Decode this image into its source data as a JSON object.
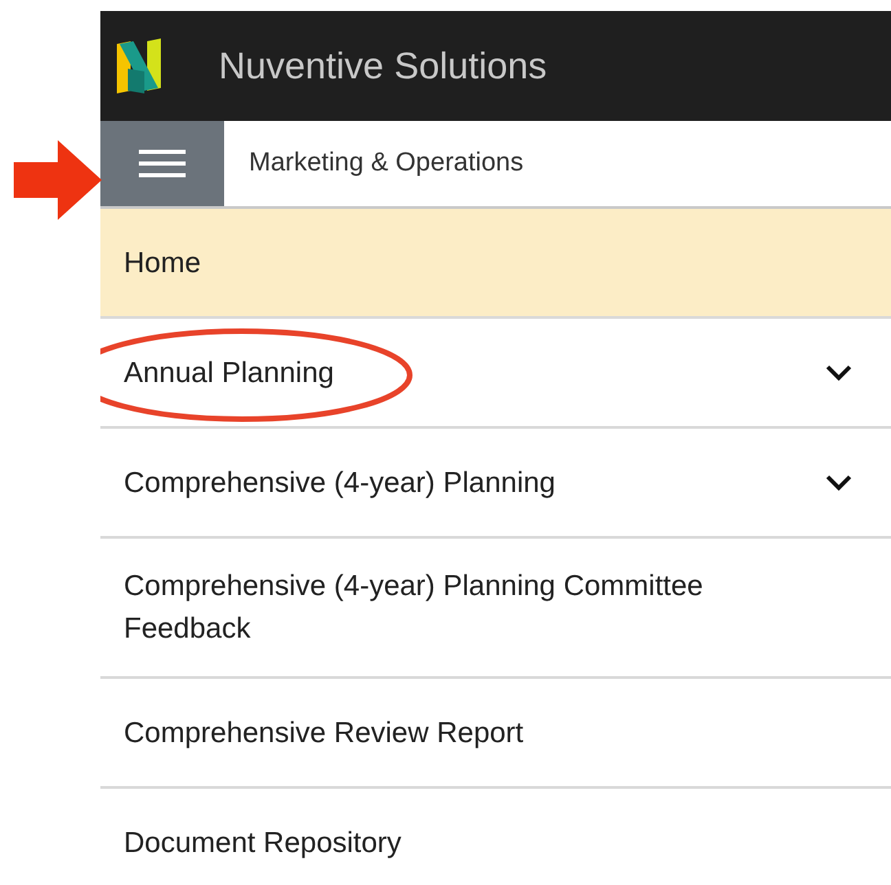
{
  "header": {
    "title": "Nuventive Solutions"
  },
  "toolbar": {
    "title": "Marketing & Operations",
    "menu_annotated": true
  },
  "nav": [
    {
      "label": "Home",
      "selected": true,
      "kind": "link",
      "circled": false
    },
    {
      "label": "Annual Planning",
      "selected": false,
      "kind": "group",
      "circled": true
    },
    {
      "label": "Comprehensive (4-year) Planning",
      "selected": false,
      "kind": "group",
      "circled": false
    },
    {
      "label": "Comprehensive (4-year) Planning Committee Feedback",
      "selected": false,
      "kind": "link",
      "circled": false
    },
    {
      "label": "Comprehensive Review Report",
      "selected": false,
      "kind": "link",
      "circled": false
    },
    {
      "label": "Document Repository",
      "selected": false,
      "kind": "link",
      "circled": false
    }
  ]
}
